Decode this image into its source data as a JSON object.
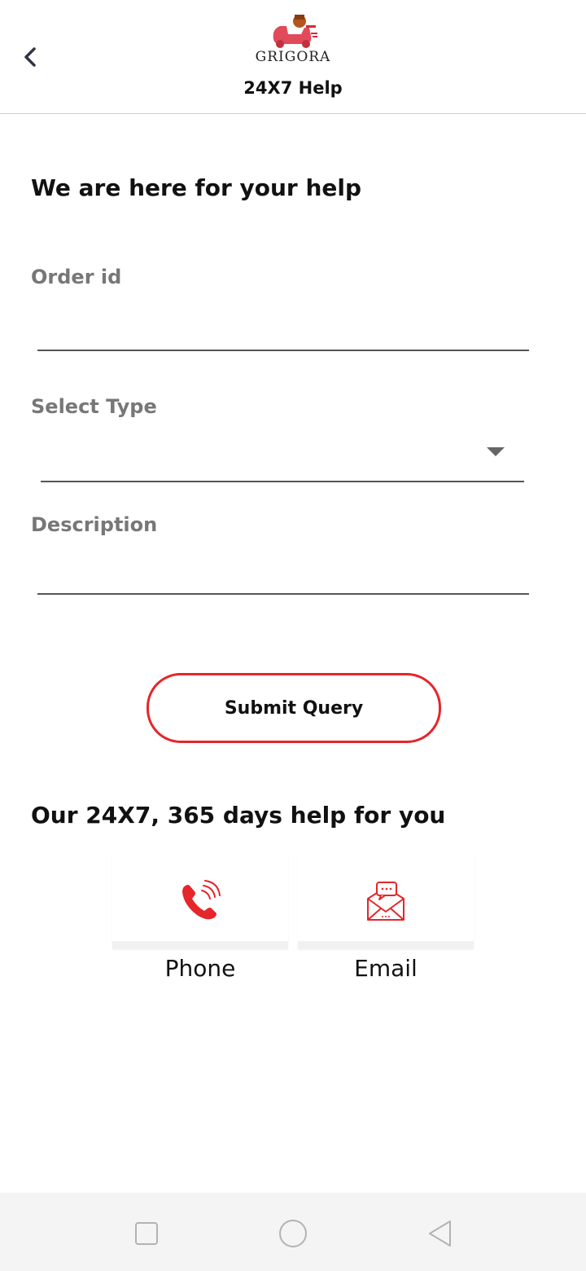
{
  "header": {
    "logo_text": "GRIGORA",
    "title": "24X7 Help",
    "back_icon": "chevron-left-icon"
  },
  "form": {
    "heading": "We are here for your help",
    "order_id": {
      "label": "Order id",
      "value": "",
      "placeholder": ""
    },
    "select_type": {
      "label": "Select Type",
      "value": ""
    },
    "description": {
      "label": "Description",
      "value": "",
      "placeholder": ""
    },
    "submit_label": "Submit Query"
  },
  "help": {
    "heading": "Our 24X7, 365 days help for you",
    "options": [
      {
        "label": "Phone",
        "icon": "phone-icon"
      },
      {
        "label": "Email",
        "icon": "email-icon"
      }
    ]
  },
  "colors": {
    "accent": "#e5262a",
    "label_gray": "#777777",
    "navbar_bg": "#f4f4f4"
  },
  "navbar": {
    "icons": [
      "recent-apps-icon",
      "home-icon",
      "back-triangle-icon"
    ]
  }
}
